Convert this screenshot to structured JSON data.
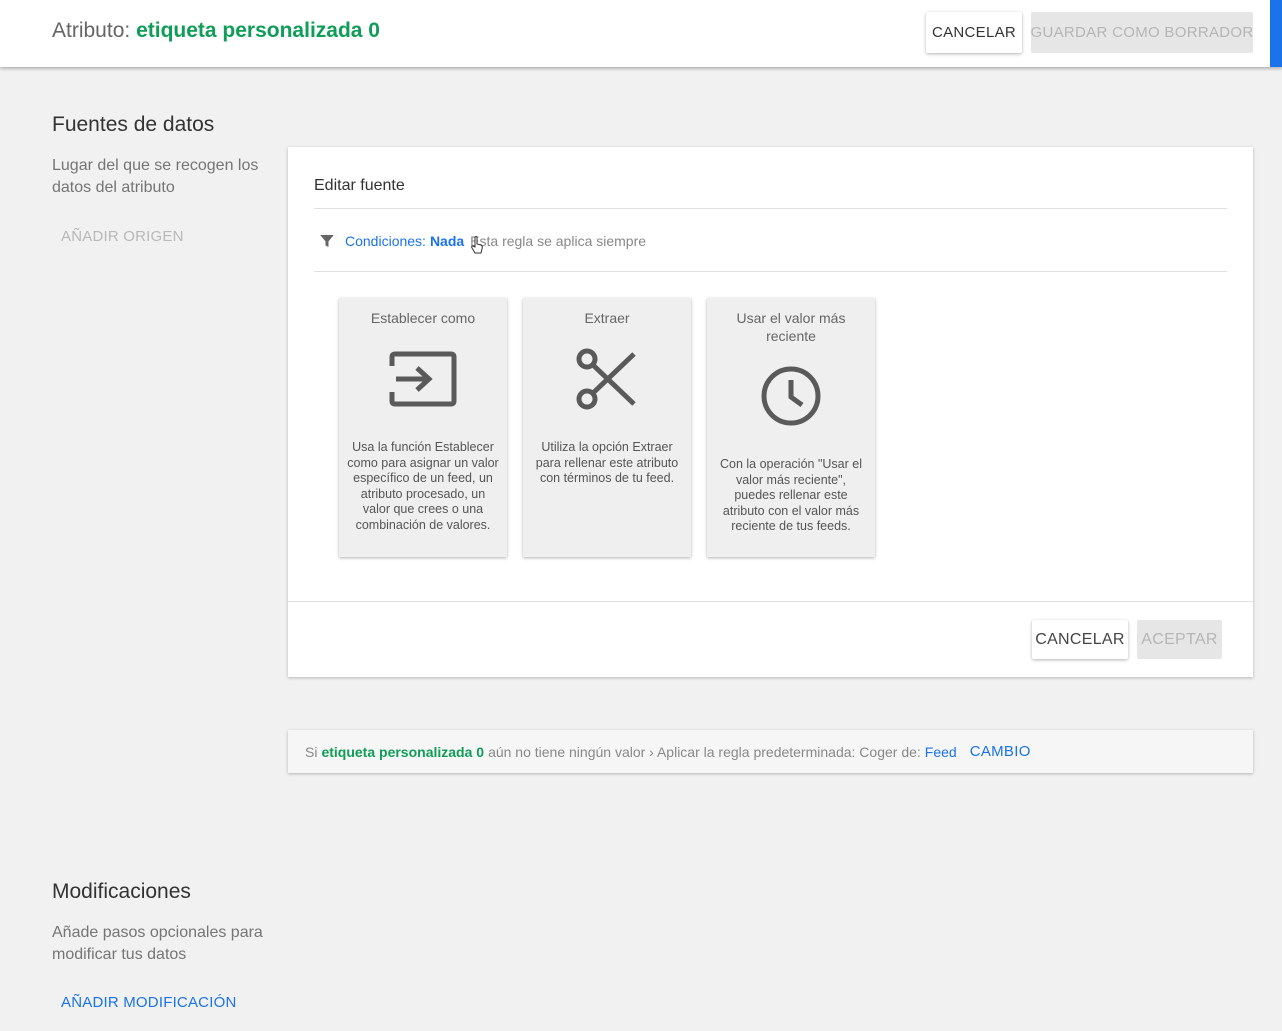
{
  "header": {
    "title_prefix": "Atributo:",
    "attribute_name": "etiqueta personalizada 0",
    "cancel_label": "CANCELAR",
    "save_draft_label": "GUARDAR COMO BORRADOR"
  },
  "sources": {
    "title": "Fuentes de datos",
    "description": "Lugar del que se recogen los datos del atributo",
    "add_origin_label": "AÑADIR ORIGEN"
  },
  "edit_source": {
    "title": "Editar fuente",
    "conditions_label": "Condiciones:",
    "conditions_value": "Nada",
    "conditions_desc": "Esta regla se aplica siempre",
    "options": [
      {
        "title": "Establecer como",
        "icon": "input-arrow-icon",
        "description": "Usa la función Establecer como para asignar un valor específico de un feed, un atributo procesado, un valor que crees o una combinación de valores."
      },
      {
        "title": "Extraer",
        "icon": "scissors-icon",
        "description": "Utiliza la opción Extraer para rellenar este atributo con términos de tu feed."
      },
      {
        "title": "Usar el valor más reciente",
        "icon": "clock-icon",
        "description": "Con la operación \"Usar el valor más reciente\", puedes rellenar este atributo con el valor más reciente de tus feeds."
      }
    ],
    "cancel_label": "CANCELAR",
    "accept_label": "ACEPTAR"
  },
  "default_rule": {
    "prefix": "Si",
    "attribute_name": "etiqueta personalizada 0",
    "middle": "aún no tiene ningún valor › Aplicar la regla predeterminada: Coger de:",
    "source": "Feed",
    "change_label": "CAMBIO"
  },
  "modifications": {
    "title": "Modificaciones",
    "description": "Añade pasos opcionales para modificar tus datos",
    "add_label": "AÑADIR MODIFICACIÓN"
  },
  "colors": {
    "accent_blue": "#1a73e8",
    "attribute_green": "#0f9d58",
    "disabled_text": "#b5b5b5"
  }
}
